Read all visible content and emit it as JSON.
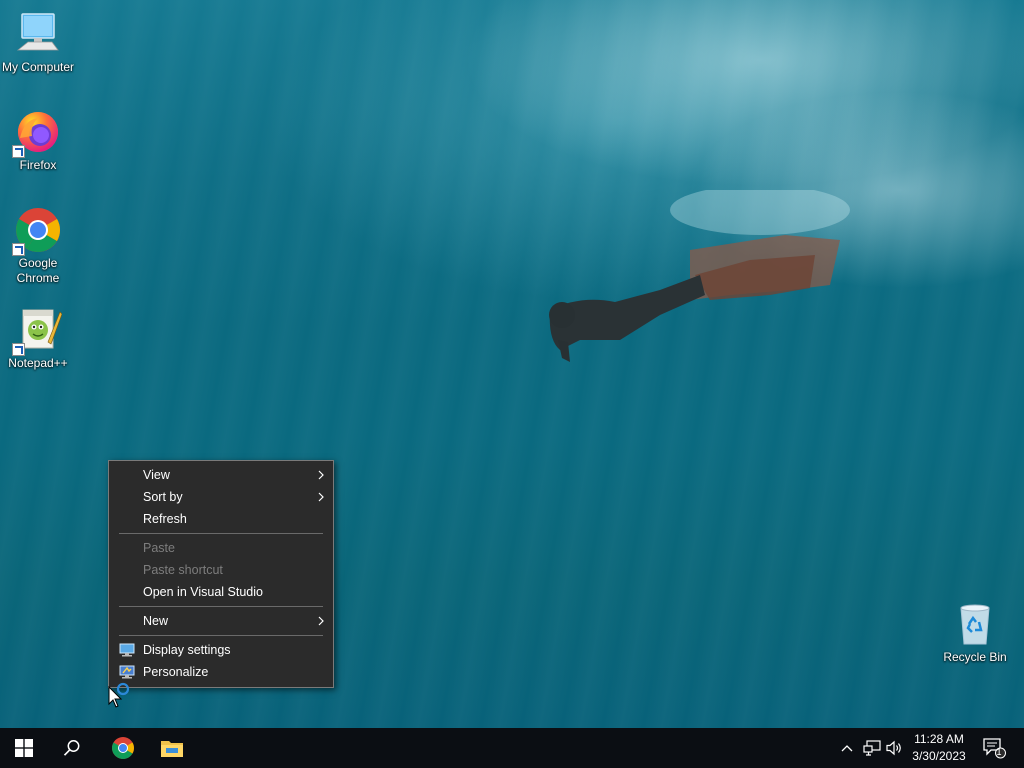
{
  "desktop": {
    "icons": [
      {
        "label": "My Computer",
        "icon": "monitor-icon",
        "shortcut": false
      },
      {
        "label": "Firefox",
        "icon": "firefox-icon",
        "shortcut": true
      },
      {
        "label": "Google Chrome",
        "icon": "chrome-icon",
        "shortcut": true
      },
      {
        "label": "Notepad++",
        "icon": "notepadpp-icon",
        "shortcut": true
      }
    ],
    "recycle_bin": {
      "label": "Recycle Bin",
      "icon": "recycle-bin-icon"
    }
  },
  "context_menu": {
    "items": [
      {
        "label": "View",
        "enabled": true,
        "submenu": true
      },
      {
        "label": "Sort by",
        "enabled": true,
        "submenu": true
      },
      {
        "label": "Refresh",
        "enabled": true,
        "submenu": false
      },
      {
        "label": "Paste",
        "enabled": false,
        "submenu": false
      },
      {
        "label": "Paste shortcut",
        "enabled": false,
        "submenu": false
      },
      {
        "label": "Open in Visual Studio",
        "enabled": true,
        "submenu": false
      },
      {
        "label": "New",
        "enabled": true,
        "submenu": true
      },
      {
        "label": "Display settings",
        "enabled": true,
        "submenu": false,
        "icon": "display-icon"
      },
      {
        "label": "Personalize",
        "enabled": true,
        "submenu": false,
        "icon": "personalize-icon"
      }
    ]
  },
  "taskbar": {
    "start_icon": "windows-logo-icon",
    "search_icon": "search-icon",
    "pinned": [
      {
        "name": "Google Chrome",
        "icon": "chrome-icon"
      },
      {
        "name": "File Explorer",
        "icon": "folder-icon"
      }
    ],
    "tray": {
      "icons": [
        "chevron-up-icon",
        "network-icon",
        "volume-icon"
      ],
      "time": "11:28 AM",
      "date": "3/30/2023",
      "notification_count": "1"
    }
  },
  "colors": {
    "taskbar_bg": "#0b0e13",
    "menu_bg": "#2b2b2b",
    "menu_disabled_text": "#7d7d7d"
  }
}
